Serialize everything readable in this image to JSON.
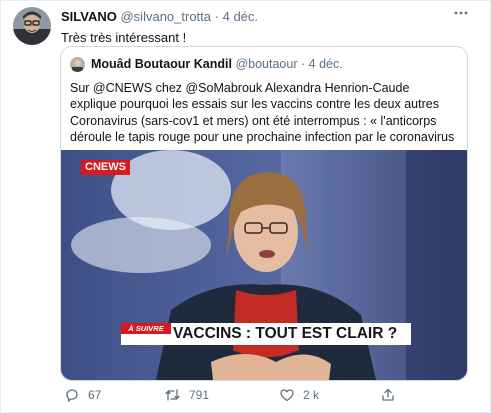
{
  "tweet": {
    "author_name": "SILVANO",
    "author_handle": "@silvano_trotta",
    "separator": "·",
    "date": "4 déc.",
    "text": "Très très intéressant !",
    "more_icon": "more-dots-icon"
  },
  "quoted_tweet": {
    "author_name": "Mouâd Boutaour Kandil",
    "author_handle": "@boutaour",
    "separator": "·",
    "date": "4 déc.",
    "text": "Sur @CNEWS chez @SoMabrouk Alexandra Henrion-Caude explique pourquoi les essais sur les vaccins contre les deux autres Coronavirus (sars-cov1 et mers) ont été interrompus : « l'anticorps déroule le tapis rouge pour une prochaine infection par le coronavirus »",
    "media": {
      "channel_logo": "CNEWS",
      "banner_tag": "À SUIVRE",
      "banner_text": "VACCINS : TOUT EST CLAIR ?"
    }
  },
  "actions": {
    "reply_count": "67",
    "retweet_count": "791",
    "like_count": "2 k",
    "icons": [
      "reply-icon",
      "retweet-icon",
      "like-icon",
      "share-icon"
    ]
  },
  "colors": {
    "text": "#0f1419",
    "muted": "#5b7083",
    "border": "#cfd9de",
    "cnews_red": "#d71920"
  }
}
